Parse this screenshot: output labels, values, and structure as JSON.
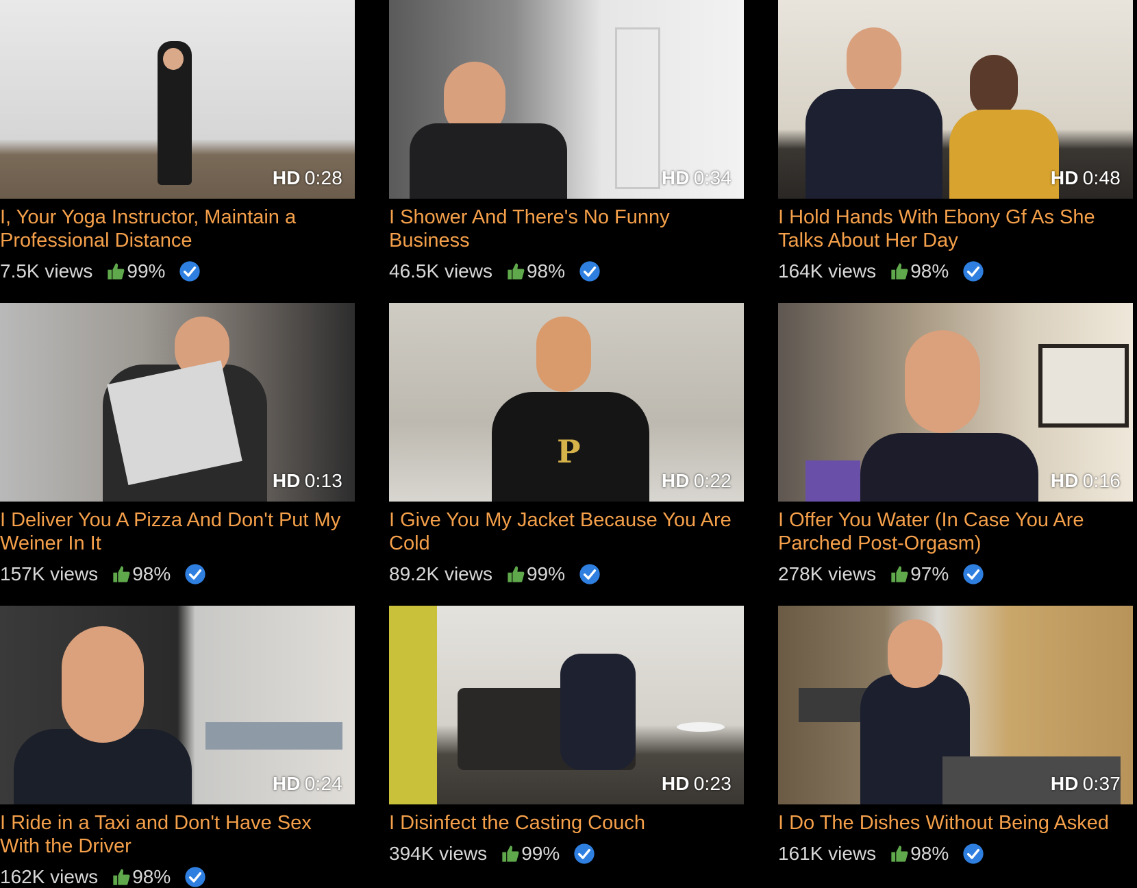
{
  "colors": {
    "background": "#000000",
    "title": "#f5a04a",
    "meta": "#d8d8d8",
    "thumbs_up": "#5fa84c",
    "verified": "#2f7fe0"
  },
  "icons": {
    "thumbs_up": "thumbs-up-icon",
    "verified": "verified-check-icon"
  },
  "videos": [
    {
      "title": "I, Your Yoga Instructor, Maintain a Professional Distance",
      "hd": "HD",
      "duration": "0:28",
      "views": "7.5K views",
      "rating": "99%"
    },
    {
      "title": "I Shower And There's No Funny Business",
      "hd": "HD",
      "duration": "0:34",
      "views": "46.5K views",
      "rating": "98%"
    },
    {
      "title": "I Hold Hands With Ebony Gf As She Talks About Her Day",
      "hd": "HD",
      "duration": "0:48",
      "views": "164K views",
      "rating": "98%"
    },
    {
      "title": "I Deliver You A Pizza And Don't Put My Weiner In It",
      "hd": "HD",
      "duration": "0:13",
      "views": "157K views",
      "rating": "98%"
    },
    {
      "title": "I Give You My Jacket Because You Are Cold",
      "hd": "HD",
      "duration": "0:22",
      "views": "89.2K views",
      "rating": "99%"
    },
    {
      "title": "I Offer You Water (In Case You Are Parched Post-Orgasm)",
      "hd": "HD",
      "duration": "0:16",
      "views": "278K views",
      "rating": "97%"
    },
    {
      "title": "I Ride in a Taxi and Don't Have Sex With the Driver",
      "hd": "HD",
      "duration": "0:24",
      "views": "162K views",
      "rating": "98%"
    },
    {
      "title": "I Disinfect the Casting Couch",
      "hd": "HD",
      "duration": "0:23",
      "views": "394K views",
      "rating": "99%"
    },
    {
      "title": "I Do The Dishes Without Being Asked",
      "hd": "HD",
      "duration": "0:37",
      "views": "161K views",
      "rating": "98%"
    }
  ]
}
